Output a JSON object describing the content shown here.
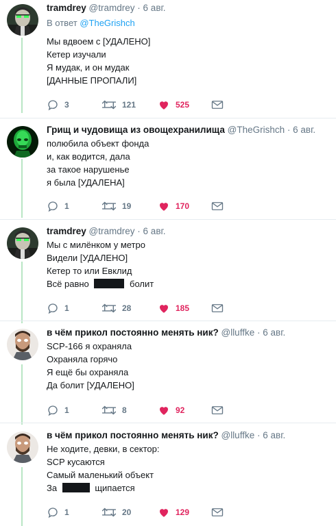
{
  "tweets": [
    {
      "display_name": "tramdrey",
      "handle": "@tramdrey",
      "date": "6 авг.",
      "reply_prefix": "В ответ",
      "reply_mention": "@TheGrishch",
      "lines": [
        "Мы вдвоем с [УДАЛЕНО]",
        "Кетер изучали",
        "Я мудак, и он мудак",
        "[ДАННЫЕ ПРОПАЛИ]"
      ],
      "replies": "3",
      "retweets": "121",
      "likes": "525",
      "avatar": "green-eyed-man-avatar"
    },
    {
      "display_name": "Грищ и чудовища из овощехранилища",
      "handle": "@TheGrishch",
      "date": "6 авг.",
      "lines": [
        "полюбила объект фонда",
        "и, как водится, дала",
        "за такое нарушенье",
        "я была [УДАЛЕНА]"
      ],
      "replies": "1",
      "retweets": "19",
      "likes": "170",
      "avatar": "green-skull-avatar"
    },
    {
      "display_name": "tramdrey",
      "handle": "@tramdrey",
      "date": "6 авг.",
      "lines": [
        "Мы с милёнком у метро",
        "Видели [УДАЛЕНО]",
        "Кетер то или Евклид"
      ],
      "redacted_line": {
        "before": "Всё равно",
        "after": "болит"
      },
      "replies": "1",
      "retweets": "28",
      "likes": "185",
      "avatar": "green-eyed-man-avatar"
    },
    {
      "display_name": "в чём прикол постоянно менять ник?",
      "handle": "@lluffke",
      "date": "6 авг.",
      "lines": [
        "SCP-166 я охраняла",
        "Охраняла горячо",
        "Я ещё бы охраняла",
        "Да болит [УДАЛЕНО]"
      ],
      "replies": "1",
      "retweets": "8",
      "likes": "92",
      "avatar": "bearded-man-avatar"
    },
    {
      "display_name": "в чём прикол постоянно менять ник?",
      "handle": "@lluffke",
      "date": "6 авг.",
      "lines": [
        "Не ходите, девки, в сектор:",
        "SCP кусаются",
        "Самый маленький объект"
      ],
      "redacted_line": {
        "before": "За",
        "after": "щипается"
      },
      "replies": "1",
      "retweets": "20",
      "likes": "129",
      "avatar": "bearded-man-avatar"
    }
  ],
  "colors": {
    "accent": "#1da1f2",
    "like": "#e0245e",
    "muted": "#657786",
    "thread_line": "#b8e6c4"
  },
  "icons": [
    "reply-icon",
    "retweet-icon",
    "like-icon",
    "direct-message-icon"
  ]
}
